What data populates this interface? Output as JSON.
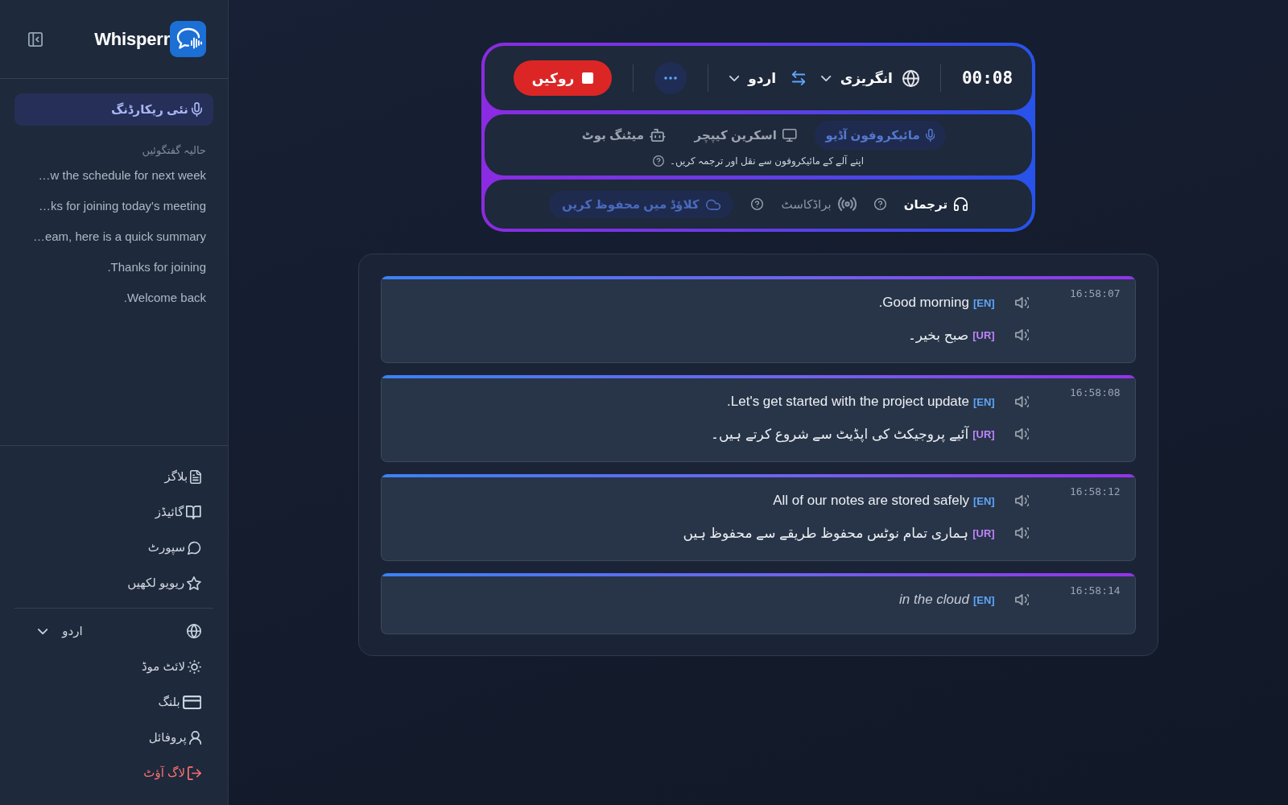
{
  "sidebar": {
    "logo": "Whisperr",
    "new_recording": "نئی ریکارڈنگ",
    "recent_heading": "حالیہ گفتگوئیں",
    "recent": [
      "…w the schedule for next week",
      "…ks for joining today's meeting",
      "…eam, here is a quick summary",
      ".Thanks for joining",
      ".Welcome back"
    ],
    "links": [
      "بلاگز",
      "گائیڈز",
      "سپورٹ",
      "ریویو لکھیں"
    ],
    "language": "اردو",
    "settings": [
      {
        "label": "لائٹ موڈ",
        "kind": "normal"
      },
      {
        "label": "بلنگ",
        "kind": "normal"
      },
      {
        "label": "پروفائل",
        "kind": "normal"
      },
      {
        "label": "لاگ آؤٹ",
        "kind": "danger"
      }
    ]
  },
  "recorder": {
    "stop_button": "روکیں",
    "source_language": "انگریزی",
    "target_language": "اردو",
    "timer": "00:08",
    "modes": [
      {
        "label": "مائیکروفون آڈیو",
        "selected": true
      },
      {
        "label": "اسکرین کیپچر",
        "selected": false
      },
      {
        "label": "میٹنگ بوٹ",
        "selected": false
      }
    ],
    "mode_hint": "اپنے آلے کے مائیکروفون سے نقل اور ترجمہ کریں۔",
    "outputs": [
      {
        "label": "ترجمان",
        "selected": true
      },
      {
        "label": "براڈکاسٹ",
        "selected": false
      }
    ],
    "cloud_save": "کلاؤڈ میں محفوظ کریں"
  },
  "transcript": [
    {
      "time": "16:58:07",
      "lines": [
        {
          "kind": "original",
          "tag": "[EN]",
          "text": ".Good morning",
          "interim": false
        },
        {
          "kind": "translation",
          "tag": "[UR]",
          "text": "صبح بخیر۔",
          "interim": false
        }
      ]
    },
    {
      "time": "16:58:08",
      "lines": [
        {
          "kind": "original",
          "tag": "[EN]",
          "text": ".Let's get started with the project update",
          "interim": false
        },
        {
          "kind": "translation",
          "tag": "[UR]",
          "text": "آئیے پروجیکٹ کی اپڈیٹ سے شروع کرتے ہیں۔",
          "interim": false
        }
      ]
    },
    {
      "time": "16:58:12",
      "lines": [
        {
          "kind": "original",
          "tag": "[EN]",
          "text": "All of our notes are stored safely",
          "interim": false
        },
        {
          "kind": "translation",
          "tag": "[UR]",
          "text": "ہماری تمام نوٹس محفوظ طریقے سے محفوظ ہیں",
          "interim": false
        }
      ]
    },
    {
      "time": "16:58:14",
      "lines": [
        {
          "kind": "original",
          "tag": "[EN]",
          "text": "in the cloud",
          "interim": true
        }
      ]
    }
  ]
}
